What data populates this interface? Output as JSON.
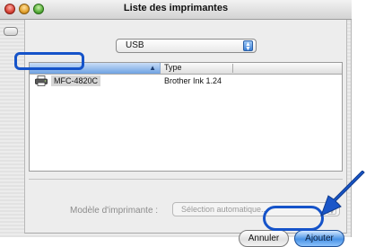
{
  "window": {
    "title": "Liste des imprimantes"
  },
  "connection": {
    "selected": "USB"
  },
  "table": {
    "columns": [
      "",
      "Type"
    ],
    "sort_indicator": "▲",
    "rows": [
      {
        "name": "MFC-4820C",
        "type": "Brother Ink 1.24",
        "icon": "printer-icon",
        "selected": true
      }
    ]
  },
  "model": {
    "label": "Modèle d'imprimante :",
    "value": "Sélection automatique..."
  },
  "buttons": {
    "cancel": "Annuler",
    "add": "Ajouter"
  },
  "colors": {
    "highlight": "#1553c9",
    "accent_blue": "#4a93e6"
  }
}
